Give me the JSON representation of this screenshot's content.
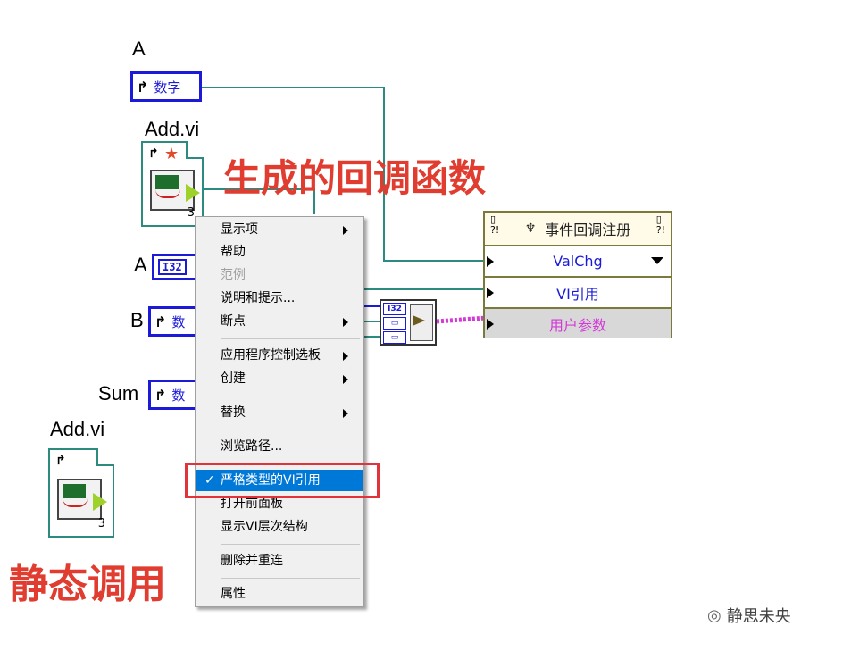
{
  "labels": {
    "a_top": "A",
    "add_vi_top": "Add.vi",
    "a_mid": "A",
    "b": "B",
    "sum": "Sum",
    "add_vi_bottom": "Add.vi"
  },
  "controls": {
    "numeric_text": "数字",
    "numeric_short": "数",
    "i32_tag": "I32"
  },
  "vi_icon": {
    "count": "3"
  },
  "annotations": {
    "generated_callback": "生成的回调函数",
    "static_call": "静态调用"
  },
  "register_node": {
    "title": "事件回调注册",
    "rows": [
      "ValChg",
      "VI引用",
      "用户参数"
    ]
  },
  "bundle": {
    "i32_tag": "I32"
  },
  "context_menu": {
    "items": [
      {
        "label": "显示项",
        "submenu": true
      },
      {
        "label": "帮助"
      },
      {
        "label": "范例",
        "disabled": true
      },
      {
        "label": "说明和提示..."
      },
      {
        "label": "断点",
        "submenu": true
      },
      {
        "label": "应用程序控制选板",
        "submenu": true
      },
      {
        "label": "创建",
        "submenu": true
      },
      {
        "label": "替换",
        "submenu": true
      },
      {
        "label": "浏览路径..."
      },
      {
        "label": "严格类型的VI引用",
        "checked": true,
        "selected": true
      },
      {
        "label": "打开前面板"
      },
      {
        "label": "显示VI层次结构"
      },
      {
        "label": "删除并重连"
      },
      {
        "label": "属性"
      }
    ]
  },
  "watermark": {
    "text": "静思未央"
  },
  "colors": {
    "wire_teal": "#2c8a7e",
    "wire_blue": "#1a1ad8",
    "wire_pink": "#d23ad6",
    "annotation_red": "#e03c2f",
    "menu_highlight": "#0078d7"
  }
}
